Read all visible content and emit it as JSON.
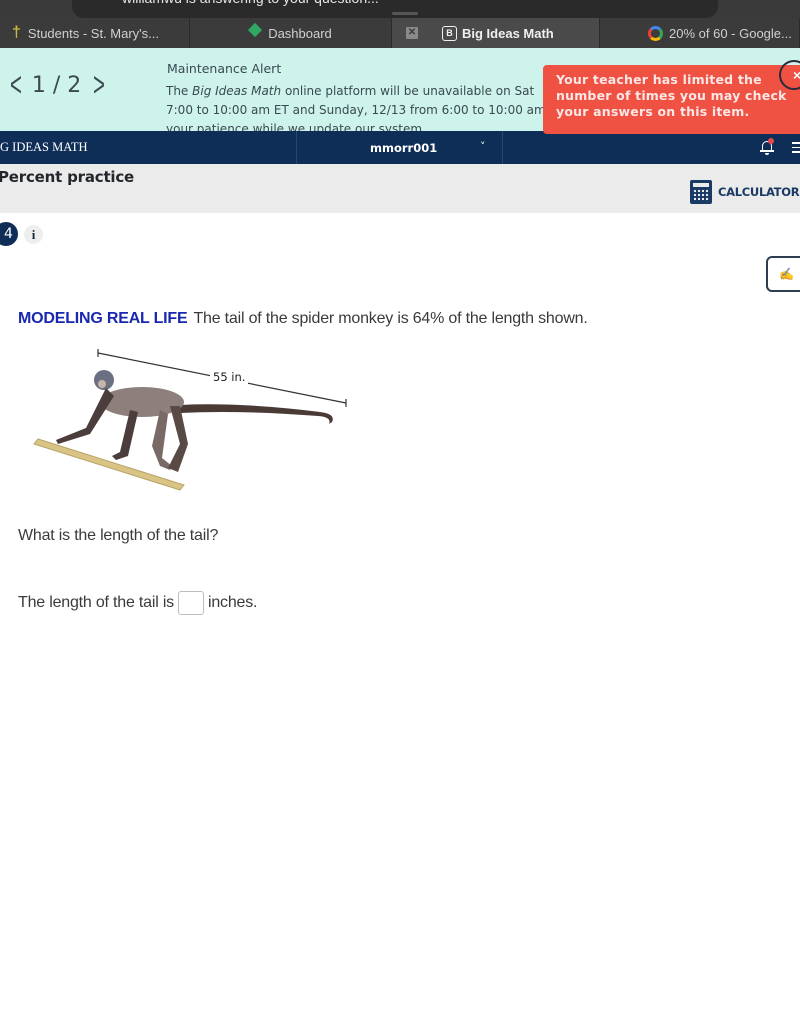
{
  "notification": {
    "text": "williamwu is answering to your question..."
  },
  "browser_tabs": [
    {
      "label": "Students - St. Mary's...",
      "icon": "school-logo-icon",
      "active": false
    },
    {
      "label": "Dashboard",
      "icon": "dashboard-logo-icon",
      "active": false
    },
    {
      "label": "Big Ideas Math",
      "icon": "b-badge-icon",
      "close_icon": "close-tab-icon",
      "active": true
    },
    {
      "label": "20% of 60 - Google...",
      "icon": "google-logo-icon",
      "active": false
    }
  ],
  "banner": {
    "pager": {
      "current": "1 / 2",
      "prev_icon": "chevron-left-icon",
      "next_icon": "chevron-right-icon"
    },
    "title": "Maintenance Alert",
    "line1_prefix": "The ",
    "line1_italic": "Big Ideas Math",
    "line1_suffix": " online platform will be unavailable on Sat",
    "line2": "7:00 to 10:00 am ET and Sunday, 12/13 from 6:00 to 10:00 am",
    "line3": "your patience while we update our system."
  },
  "toast": {
    "message": "Your teacher has limited the number of times you may check your answers on this item.",
    "color": "#ef5143",
    "close_label": "×"
  },
  "appbar": {
    "brand": "G IDEAS MATH",
    "username": "mmorr001",
    "caret": "˅",
    "color": "#0f2e57"
  },
  "assignment": {
    "title": "Percent practice",
    "calculators_label": "CALCULATORS"
  },
  "question": {
    "number": "4",
    "info_label": "i",
    "tag": "MODELING REAL LIFE",
    "prompt": "The tail of the spider monkey is 64% of the length shown.",
    "figure_dimension": "55 in.",
    "ask": "What is the length of the tail?",
    "answer_prefix": "The length of the tail is",
    "answer_value": "",
    "answer_suffix": "inches."
  },
  "tts_button": {
    "icon": "audio-off-icon",
    "glyph": "✍"
  }
}
